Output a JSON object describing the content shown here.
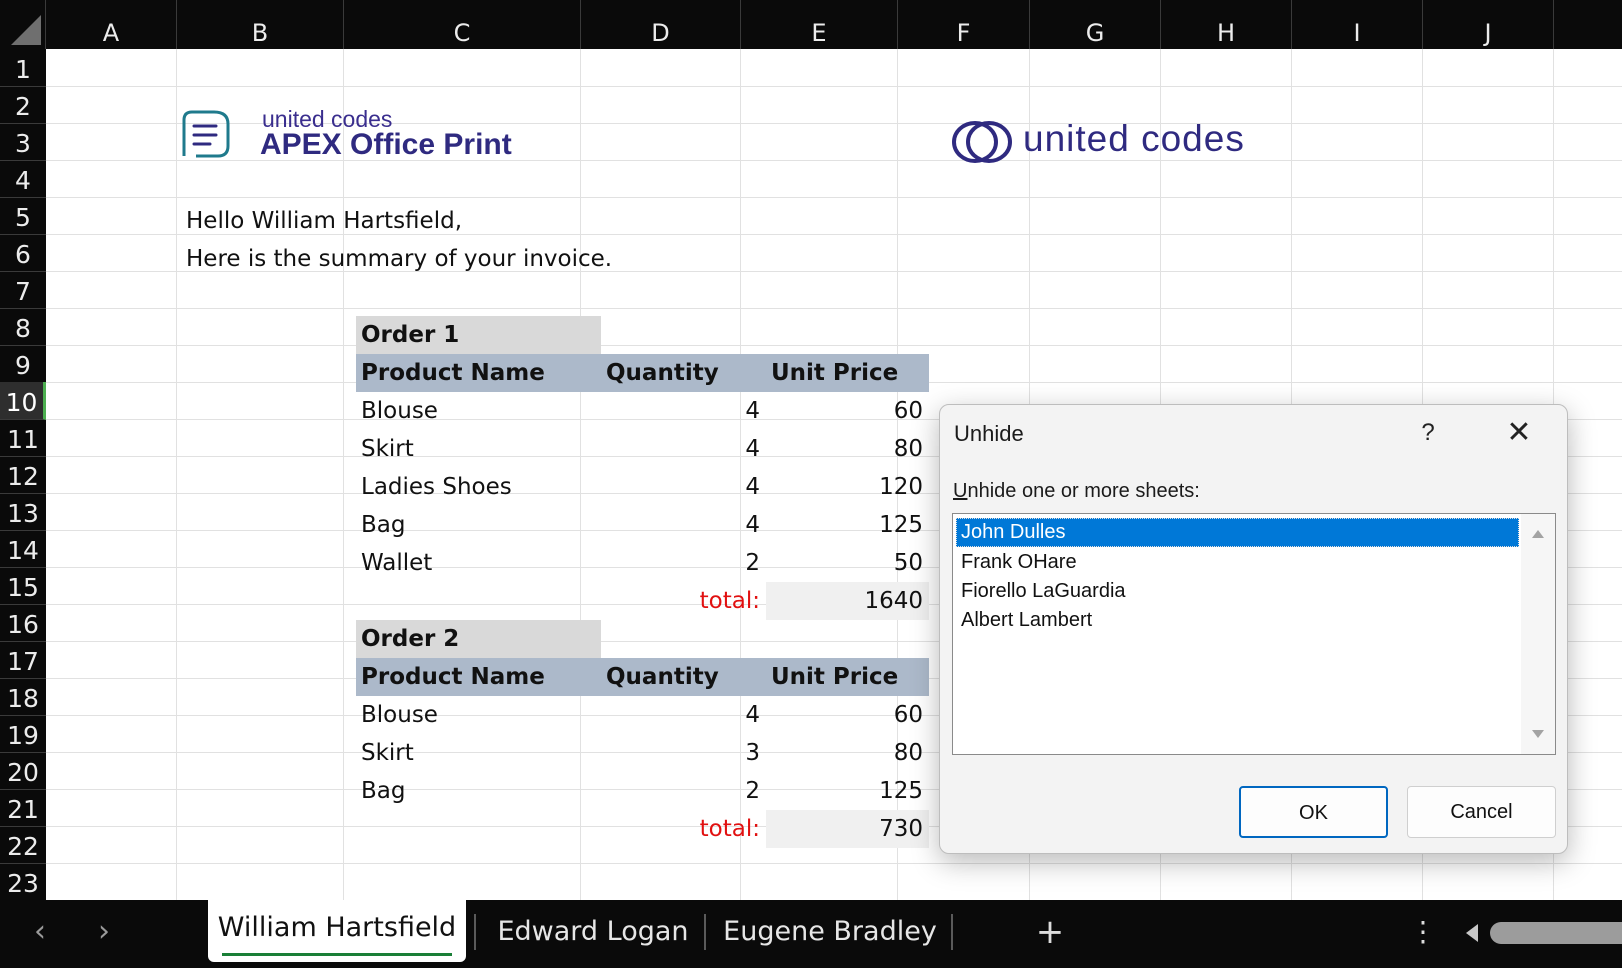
{
  "columns": [
    "A",
    "B",
    "C",
    "D",
    "E",
    "F",
    "G",
    "H",
    "I",
    "J"
  ],
  "rows": [
    "1",
    "2",
    "3",
    "4",
    "5",
    "6",
    "7",
    "8",
    "9",
    "10",
    "11",
    "12",
    "13",
    "14",
    "15",
    "16",
    "17",
    "18",
    "19",
    "20",
    "21",
    "22",
    "23"
  ],
  "selected_row": "10",
  "logos": {
    "aop_small": "united codes",
    "aop_big": "APEX Office Print",
    "uc_text": "united codes"
  },
  "greeting": "Hello William Hartsfield,",
  "summary_line": "Here is the summary of your invoice.",
  "orders": [
    {
      "title": "Order 1",
      "headers": [
        "Product Name",
        "Quantity",
        "Unit Price"
      ],
      "items": [
        {
          "product": "Blouse",
          "quantity": "4",
          "price": "60"
        },
        {
          "product": "Skirt",
          "quantity": "4",
          "price": "80"
        },
        {
          "product": "Ladies Shoes",
          "quantity": "4",
          "price": "120"
        },
        {
          "product": "Bag",
          "quantity": "4",
          "price": "125"
        },
        {
          "product": "Wallet",
          "quantity": "2",
          "price": "50"
        }
      ],
      "total_label": "total:",
      "total_value": "1640"
    },
    {
      "title": "Order 2",
      "headers": [
        "Product Name",
        "Quantity",
        "Unit Price"
      ],
      "items": [
        {
          "product": "Blouse",
          "quantity": "4",
          "price": "60"
        },
        {
          "product": "Skirt",
          "quantity": "3",
          "price": "80"
        },
        {
          "product": "Bag",
          "quantity": "2",
          "price": "125"
        }
      ],
      "total_label": "total:",
      "total_value": "730"
    }
  ],
  "sheet_tabs": {
    "prev_icon": "chevron-left-icon",
    "next_icon": "chevron-right-icon",
    "tabs": [
      "William Hartsfield",
      "Edward Logan",
      "Eugene Bradley"
    ],
    "active": "William Hartsfield",
    "add_label": "+",
    "more_label": "⋮"
  },
  "dialog": {
    "title": "Unhide",
    "help_label": "?",
    "close_label": "✕",
    "prompt_accel": "U",
    "prompt_rest": "nhide one or more sheets:",
    "sheets": [
      "John Dulles",
      "Frank OHare",
      "Fiorello LaGuardia",
      "Albert Lambert"
    ],
    "selected_sheet": "John Dulles",
    "ok_label": "OK",
    "cancel_label": "Cancel"
  },
  "colors": {
    "order_header_bg": "#d9d9d9",
    "column_header_bg": "#acb9ca",
    "total_label": "#e11010",
    "selection": "#0078d7",
    "brand": "#2f2a80"
  }
}
